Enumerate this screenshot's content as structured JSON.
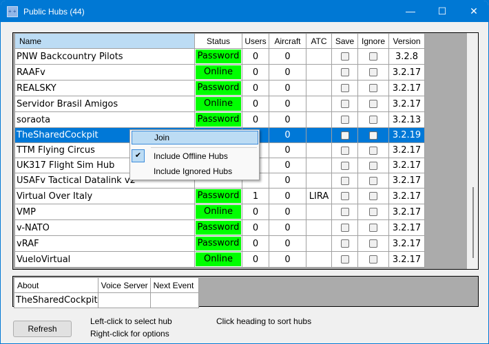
{
  "window": {
    "title": "Public Hubs (44)",
    "minimize": "—",
    "maximize": "☐",
    "close": "✕"
  },
  "columns": [
    "Name",
    "Status",
    "Users",
    "Aircraft",
    "ATC",
    "Save",
    "Ignore",
    "Version"
  ],
  "rows": [
    {
      "name": "PNW Backcountry Pilots",
      "status": "Password",
      "users": "0",
      "aircraft": "0",
      "atc": "",
      "version": "3.2.8"
    },
    {
      "name": "RAAFv",
      "status": "Online",
      "users": "0",
      "aircraft": "0",
      "atc": "",
      "version": "3.2.17"
    },
    {
      "name": "REALSKY",
      "status": "Password",
      "users": "0",
      "aircraft": "0",
      "atc": "",
      "version": "3.2.17"
    },
    {
      "name": "Servidor Brasil Amigos",
      "status": "Online",
      "users": "0",
      "aircraft": "0",
      "atc": "",
      "version": "3.2.17"
    },
    {
      "name": "soraota",
      "status": "Password",
      "users": "0",
      "aircraft": "0",
      "atc": "",
      "version": "3.2.13"
    },
    {
      "name": "TheSharedCockpit",
      "status": "",
      "users": "",
      "aircraft": "0",
      "atc": "",
      "version": "3.2.19",
      "selected": true
    },
    {
      "name": "TTM Flying Circus",
      "status": "",
      "users": "",
      "aircraft": "0",
      "atc": "",
      "version": "3.2.17"
    },
    {
      "name": "UK317 Flight Sim Hub",
      "status": "",
      "users": "",
      "aircraft": "0",
      "atc": "",
      "version": "3.2.17"
    },
    {
      "name": "USAFv Tactical Datalink v2",
      "status": "",
      "users": "",
      "aircraft": "0",
      "atc": "",
      "version": "3.2.17"
    },
    {
      "name": "Virtual Over Italy",
      "status": "Password",
      "users": "1",
      "aircraft": "0",
      "atc": "LIRA",
      "version": "3.2.17"
    },
    {
      "name": "VMP",
      "status": "Online",
      "users": "0",
      "aircraft": "0",
      "atc": "",
      "version": "3.2.17"
    },
    {
      "name": "v-NATO",
      "status": "Password",
      "users": "0",
      "aircraft": "0",
      "atc": "",
      "version": "3.2.17"
    },
    {
      "name": "vRAF",
      "status": "Password",
      "users": "0",
      "aircraft": "0",
      "atc": "",
      "version": "3.2.17"
    },
    {
      "name": "VueloVirtual",
      "status": "Online",
      "users": "0",
      "aircraft": "0",
      "atc": "",
      "version": "3.2.17"
    }
  ],
  "context_menu": {
    "join": "Join",
    "include_offline": "Include Offline Hubs",
    "include_offline_checked": true,
    "include_ignored": "Include Ignored Hubs"
  },
  "details": {
    "columns": [
      "About",
      "Voice Server",
      "Next Event"
    ],
    "values": [
      "TheSharedCockpit",
      "",
      ""
    ]
  },
  "footer": {
    "refresh": "Refresh",
    "hint1": "Left-click to select hub",
    "hint2": "Right-click for options",
    "hint3": "Click heading to sort hubs"
  },
  "colors": {
    "status_bg": "#00ff00",
    "selection": "#0078d7",
    "titlebar": "#0078d4"
  }
}
